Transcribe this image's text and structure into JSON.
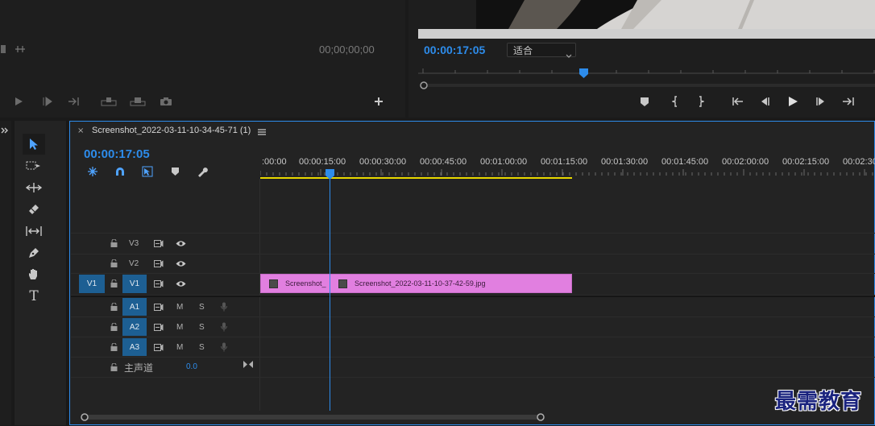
{
  "source_monitor": {
    "timecode": "00;00;00;00"
  },
  "program_monitor": {
    "timecode": "00:00:17:05",
    "zoom_select": "适合"
  },
  "timeline": {
    "tab_title": "Screenshot_2022-03-11-10-34-45-71 (1)",
    "timecode": "00:00:17:05",
    "ruler_labels": [
      ":00:00",
      "00:00:15:00",
      "00:00:30:00",
      "00:00:45:00",
      "00:01:00:00",
      "00:01:15:00",
      "00:01:30:00",
      "00:01:45:00",
      "00:02:00:00",
      "00:02:15:00",
      "00:02:30"
    ],
    "tracks_video": [
      {
        "name": "V3",
        "target": ""
      },
      {
        "name": "V2",
        "target": ""
      },
      {
        "name": "V1",
        "target": "V1"
      }
    ],
    "tracks_audio": [
      {
        "name": "A1",
        "m": "M",
        "s": "S"
      },
      {
        "name": "A2",
        "m": "M",
        "s": "S"
      },
      {
        "name": "A3",
        "m": "M",
        "s": "S"
      }
    ],
    "master": {
      "label": "主声道",
      "value": "0.0"
    },
    "clips": [
      {
        "label": "Screenshot_"
      },
      {
        "label": "Screenshot_2022-03-11-10-37-42-59.jpg"
      }
    ]
  },
  "watermark": "最需教育",
  "colors": {
    "accent": "#2d8ceb",
    "clip": "#e17fe0",
    "work_area": "#e8d800"
  }
}
